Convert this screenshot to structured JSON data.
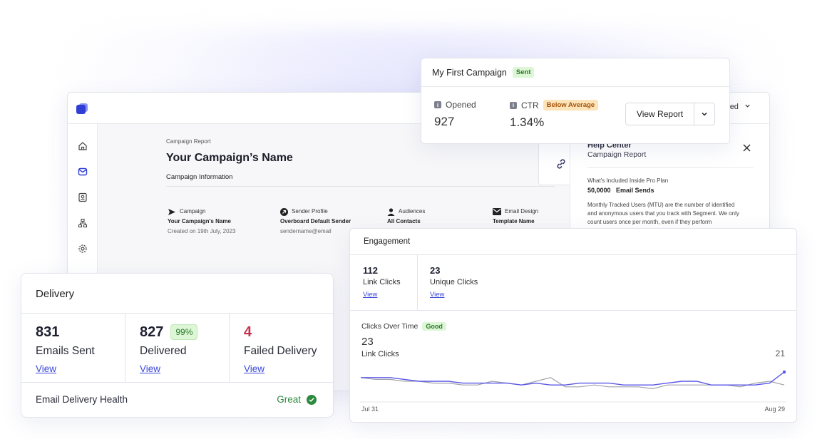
{
  "app": {
    "account_label": "ed",
    "crumb": "Campaign Report",
    "title": "Your Campaign’s Name",
    "section": "Campaign Information",
    "info": [
      {
        "label": "Campaign",
        "value": "Your Campaign's Name",
        "sub": "Created on 19th July, 2023",
        "icon": "send-icon"
      },
      {
        "label": "Sender Profile",
        "value": "Overboard Default Sender",
        "sub": "sendername@email",
        "icon": "arrow-circle-icon"
      },
      {
        "label": "Audiences",
        "value": "All Contacts",
        "sub": "",
        "icon": "user-icon"
      },
      {
        "label": "Email Design",
        "value": "Template Name",
        "sub": "",
        "icon": "mail-icon"
      }
    ],
    "help": {
      "title": "Help Center",
      "subtitle": "Campaign Report",
      "plan_label": "What's Included Inside Pro Plan",
      "plan_value": "50,0000   Email Sends",
      "paragraph": "Monthly Tracked Users (MTU) are the number of identified and anonymous users that you track with Segment. We only count users once per month, even if they perform"
    },
    "sidebar_icons": [
      "home-icon",
      "inbox-icon",
      "contacts-icon",
      "hierarchy-icon",
      "settings-icon"
    ]
  },
  "campaign": {
    "name": "My First Campaign",
    "status": "Sent",
    "opened_label": "Opened",
    "opened_value": "927",
    "ctr_label": "CTR",
    "ctr_badge": "Below Average",
    "ctr_value": "1.34%",
    "view_report": "View Report"
  },
  "delivery": {
    "title": "Delivery",
    "cols": [
      {
        "value": "831",
        "label": "Emails Sent",
        "link": "View"
      },
      {
        "value": "827",
        "label": "Delivered",
        "link": "View",
        "badge": "99%"
      },
      {
        "value": "4",
        "label": "Failed Delivery",
        "link": "View"
      }
    ],
    "health_label": "Email Delivery Health",
    "health_value": "Great"
  },
  "engagement": {
    "title": "Engagement",
    "stats": [
      {
        "value": "112",
        "label": "Link Clicks",
        "link": "View"
      },
      {
        "value": "23",
        "label": "Unique Clicks",
        "link": "View"
      }
    ],
    "chart_title": "Clicks Over Time",
    "chart_badge": "Good",
    "chart_big": "23",
    "chart_sub": "Link Clicks",
    "chart_right": "21",
    "x_start": "Jul 31",
    "x_end": "Aug 29"
  },
  "colors": {
    "accent": "#3a48d8",
    "good": "#2d8a3e",
    "bad": "#c4314b"
  },
  "chart_data": {
    "type": "line",
    "x": [
      "Jul 31",
      "",
      "",
      "",
      "",
      "",
      "",
      "",
      "",
      "",
      "",
      "",
      "",
      "",
      "",
      "",
      "",
      "",
      "",
      "",
      "",
      "",
      "",
      "",
      "",
      "",
      "",
      "",
      "",
      "Aug 29"
    ],
    "series": [
      {
        "values": [
          12,
          12,
          12,
          11,
          10,
          10,
          10,
          9,
          9,
          9,
          9,
          8,
          9,
          8,
          8,
          9,
          9,
          9,
          8,
          8,
          8,
          9,
          10,
          10,
          8,
          8,
          8,
          8,
          9,
          15
        ]
      },
      {
        "values": [
          12,
          11,
          11,
          10,
          10,
          9,
          9,
          8,
          8,
          10,
          9,
          8,
          10,
          12,
          7,
          7,
          8,
          7,
          7,
          7,
          6,
          8,
          8,
          8,
          8,
          8,
          7,
          9,
          10,
          8
        ]
      }
    ],
    "ylim": [
      0,
      20
    ]
  }
}
